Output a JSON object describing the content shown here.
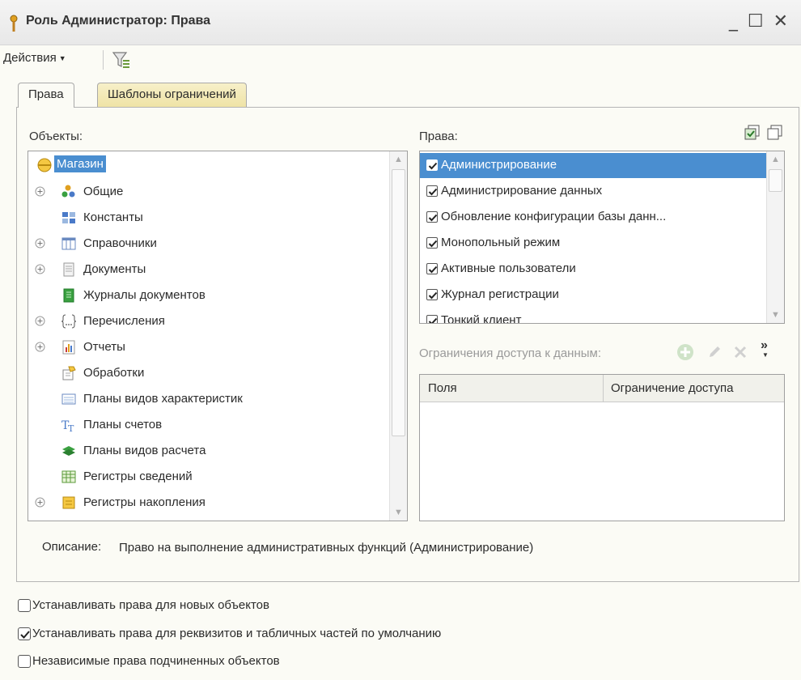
{
  "window": {
    "title": "Роль Администратор: Права",
    "minimize": "_",
    "maximize": "☐",
    "close": "✕"
  },
  "toolbar": {
    "actions_label": "Действия",
    "filter_icon": "filter-settings-icon"
  },
  "tabs": [
    {
      "label": "Права",
      "active": true
    },
    {
      "label": "Шаблоны ограничений",
      "active": false
    }
  ],
  "objects_panel": {
    "label": "Объекты:",
    "items": [
      {
        "label": "Магазин",
        "icon": "configuration-icon",
        "expandable": false,
        "selected": true
      },
      {
        "label": "Общие",
        "icon": "common-icon",
        "expandable": true
      },
      {
        "label": "Константы",
        "icon": "constants-icon",
        "expandable": false
      },
      {
        "label": "Справочники",
        "icon": "catalogs-icon",
        "expandable": true
      },
      {
        "label": "Документы",
        "icon": "documents-icon",
        "expandable": true
      },
      {
        "label": "Журналы документов",
        "icon": "document-journals-icon",
        "expandable": false
      },
      {
        "label": "Перечисления",
        "icon": "enums-icon",
        "expandable": true
      },
      {
        "label": "Отчеты",
        "icon": "reports-icon",
        "expandable": true
      },
      {
        "label": "Обработки",
        "icon": "data-processors-icon",
        "expandable": false
      },
      {
        "label": "Планы видов характеристик",
        "icon": "chart-of-characteristics-icon",
        "expandable": false
      },
      {
        "label": "Планы счетов",
        "icon": "chart-of-accounts-icon",
        "expandable": false
      },
      {
        "label": "Планы видов расчета",
        "icon": "chart-of-calculation-types-icon",
        "expandable": false
      },
      {
        "label": "Регистры сведений",
        "icon": "information-registers-icon",
        "expandable": false
      },
      {
        "label": "Регистры накопления",
        "icon": "accumulation-registers-icon",
        "expandable": true
      }
    ]
  },
  "rights_panel": {
    "label": "Права:",
    "items": [
      {
        "label": "Администрирование",
        "checked": true,
        "selected": true
      },
      {
        "label": "Администрирование данных",
        "checked": true
      },
      {
        "label": "Обновление конфигурации базы данн...",
        "checked": true
      },
      {
        "label": "Монопольный режим",
        "checked": true
      },
      {
        "label": "Активные пользователи",
        "checked": true
      },
      {
        "label": "Журнал регистрации",
        "checked": true
      },
      {
        "label": "Тонкий клиент",
        "checked": true
      }
    ]
  },
  "restrictions": {
    "label": "Ограничения доступа к данным:",
    "columns": [
      "Поля",
      "Ограничение доступа"
    ],
    "more": "»"
  },
  "description": {
    "key": "Описание:",
    "value": "Право на выполнение административных функций (Администрирование)"
  },
  "options": [
    {
      "label": "Устанавливать права для новых объектов",
      "checked": false
    },
    {
      "label": "Устанавливать права для реквизитов и табличных частей по умолчанию",
      "checked": true
    },
    {
      "label": "Независимые права подчиненных объектов",
      "checked": false
    }
  ]
}
